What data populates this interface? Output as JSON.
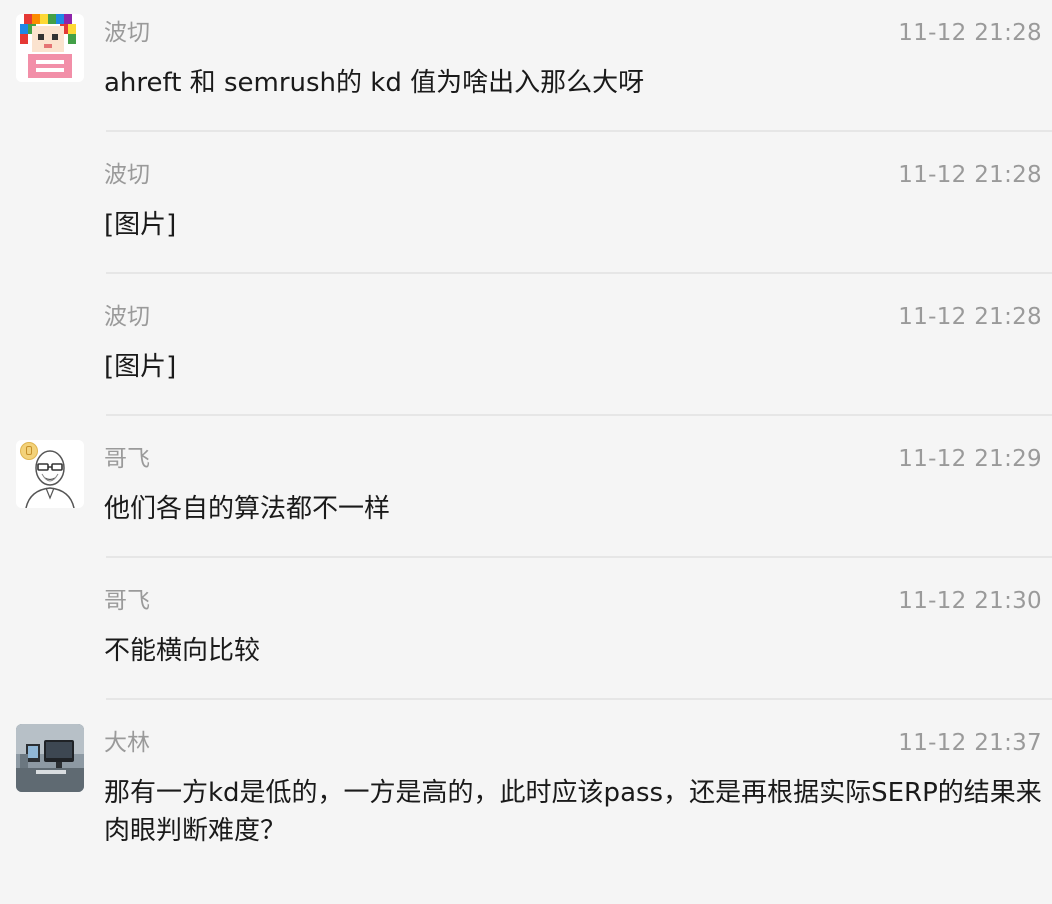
{
  "messages": [
    {
      "sender": "波切",
      "time": "11-12 21:28",
      "text": "ahreft 和 semrush的 kd 值为啥出入那么大呀"
    },
    {
      "sender": "波切",
      "time": "11-12 21:28",
      "text": "[图片]"
    },
    {
      "sender": "波切",
      "time": "11-12 21:28",
      "text": "[图片]"
    },
    {
      "sender": "哥飞",
      "time": "11-12 21:29",
      "text": "他们各自的算法都不一样"
    },
    {
      "sender": "哥飞",
      "time": "11-12 21:30",
      "text": "不能横向比较"
    },
    {
      "sender": "大林",
      "time": "11-12 21:37",
      "text": "那有一方kd是低的，一方是高的，此时应该pass，还是再根据实际SERP的结果来肉眼判断难度？"
    }
  ],
  "avatars": {
    "bochie": "pixel-art-avatar",
    "gefei": "bald-man-glasses-avatar",
    "dalin": "desk-setup-photo-avatar"
  },
  "colors": {
    "background": "#f5f5f5",
    "text": "#1a1a1a",
    "meta": "#9a9a9a",
    "divider": "#e6e6e6"
  }
}
